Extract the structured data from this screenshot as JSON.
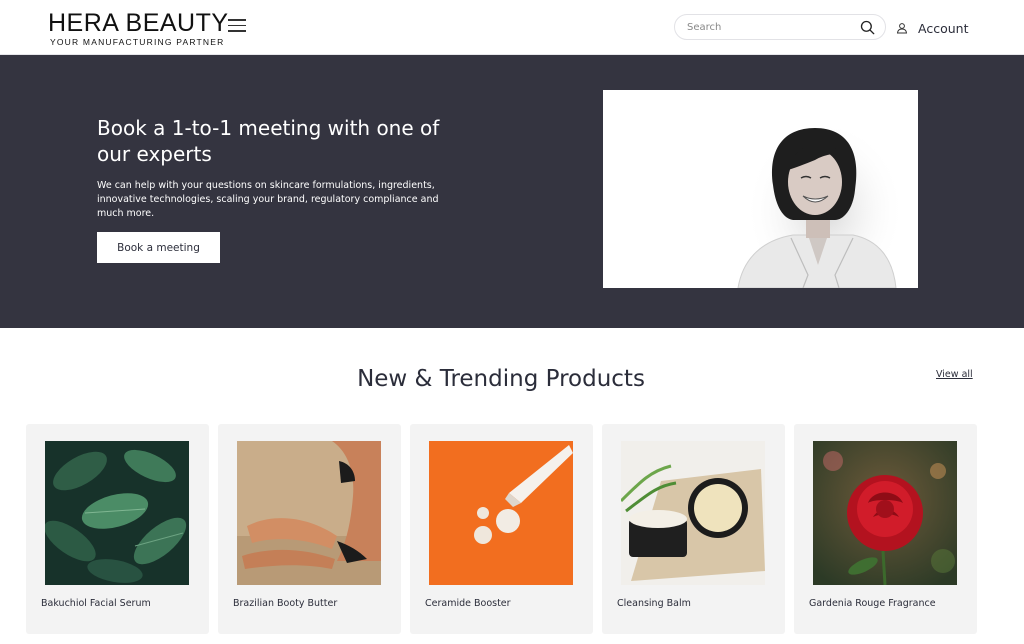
{
  "header": {
    "logo_title": "HERA BEAUTY",
    "logo_tagline": "YOUR MANUFACTURING PARTNER",
    "search_placeholder": "Search",
    "account_label": "Account"
  },
  "hero": {
    "title": "Book a 1-to-1 meeting with one of our experts",
    "text": "We can help with your questions on skincare formulations, ingredients, innovative technologies, scaling your brand, regulatory compliance and much more.",
    "button_label": "Book a meeting",
    "background_color": "#343440"
  },
  "products": {
    "title": "New & Trending Products",
    "view_all_label": "View all",
    "items": [
      {
        "name": "Bakuchiol Facial Serum"
      },
      {
        "name": "Brazilian Booty Butter"
      },
      {
        "name": "Ceramide Booster"
      },
      {
        "name": "Cleansing Balm"
      },
      {
        "name": "Gardenia Rouge Fragrance"
      }
    ]
  }
}
